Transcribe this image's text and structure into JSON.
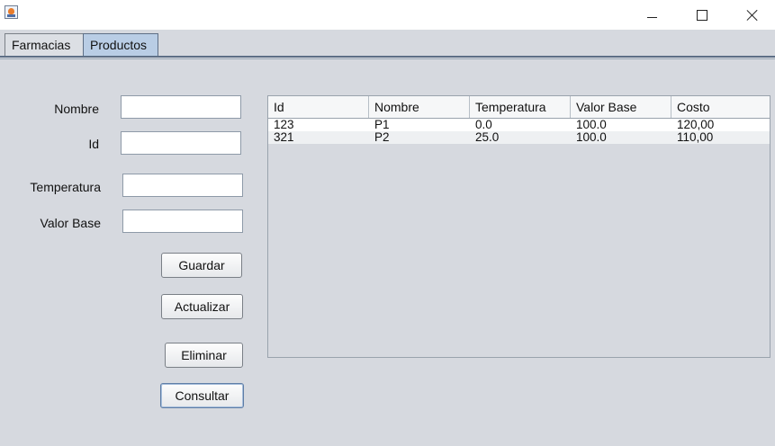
{
  "window": {
    "minimize_icon": "minimize-icon",
    "maximize_icon": "maximize-icon",
    "close_icon": "close-icon"
  },
  "tabs": [
    {
      "label": "Farmacias",
      "selected": false
    },
    {
      "label": "Productos",
      "selected": true
    }
  ],
  "form": {
    "nombre": {
      "label": "Nombre",
      "value": ""
    },
    "id": {
      "label": "Id",
      "value": ""
    },
    "temperatura": {
      "label": "Temperatura",
      "value": ""
    },
    "valor_base": {
      "label": "Valor Base",
      "value": ""
    }
  },
  "buttons": {
    "guardar": "Guardar",
    "actualizar": "Actualizar",
    "eliminar": "Eliminar",
    "consultar": "Consultar"
  },
  "table": {
    "columns": [
      "Id",
      "Nombre",
      "Temperatura",
      "Valor Base",
      "Costo"
    ],
    "rows": [
      [
        "123",
        "P1",
        "0.0",
        "100.0",
        "120,00"
      ],
      [
        "321",
        "P2",
        "25.0",
        "100.0",
        "110,00"
      ]
    ]
  },
  "colors": {
    "window_bg": "#d6d9df",
    "selected_tab": "#b9cde5",
    "tab_rule": "#5e6f86"
  }
}
